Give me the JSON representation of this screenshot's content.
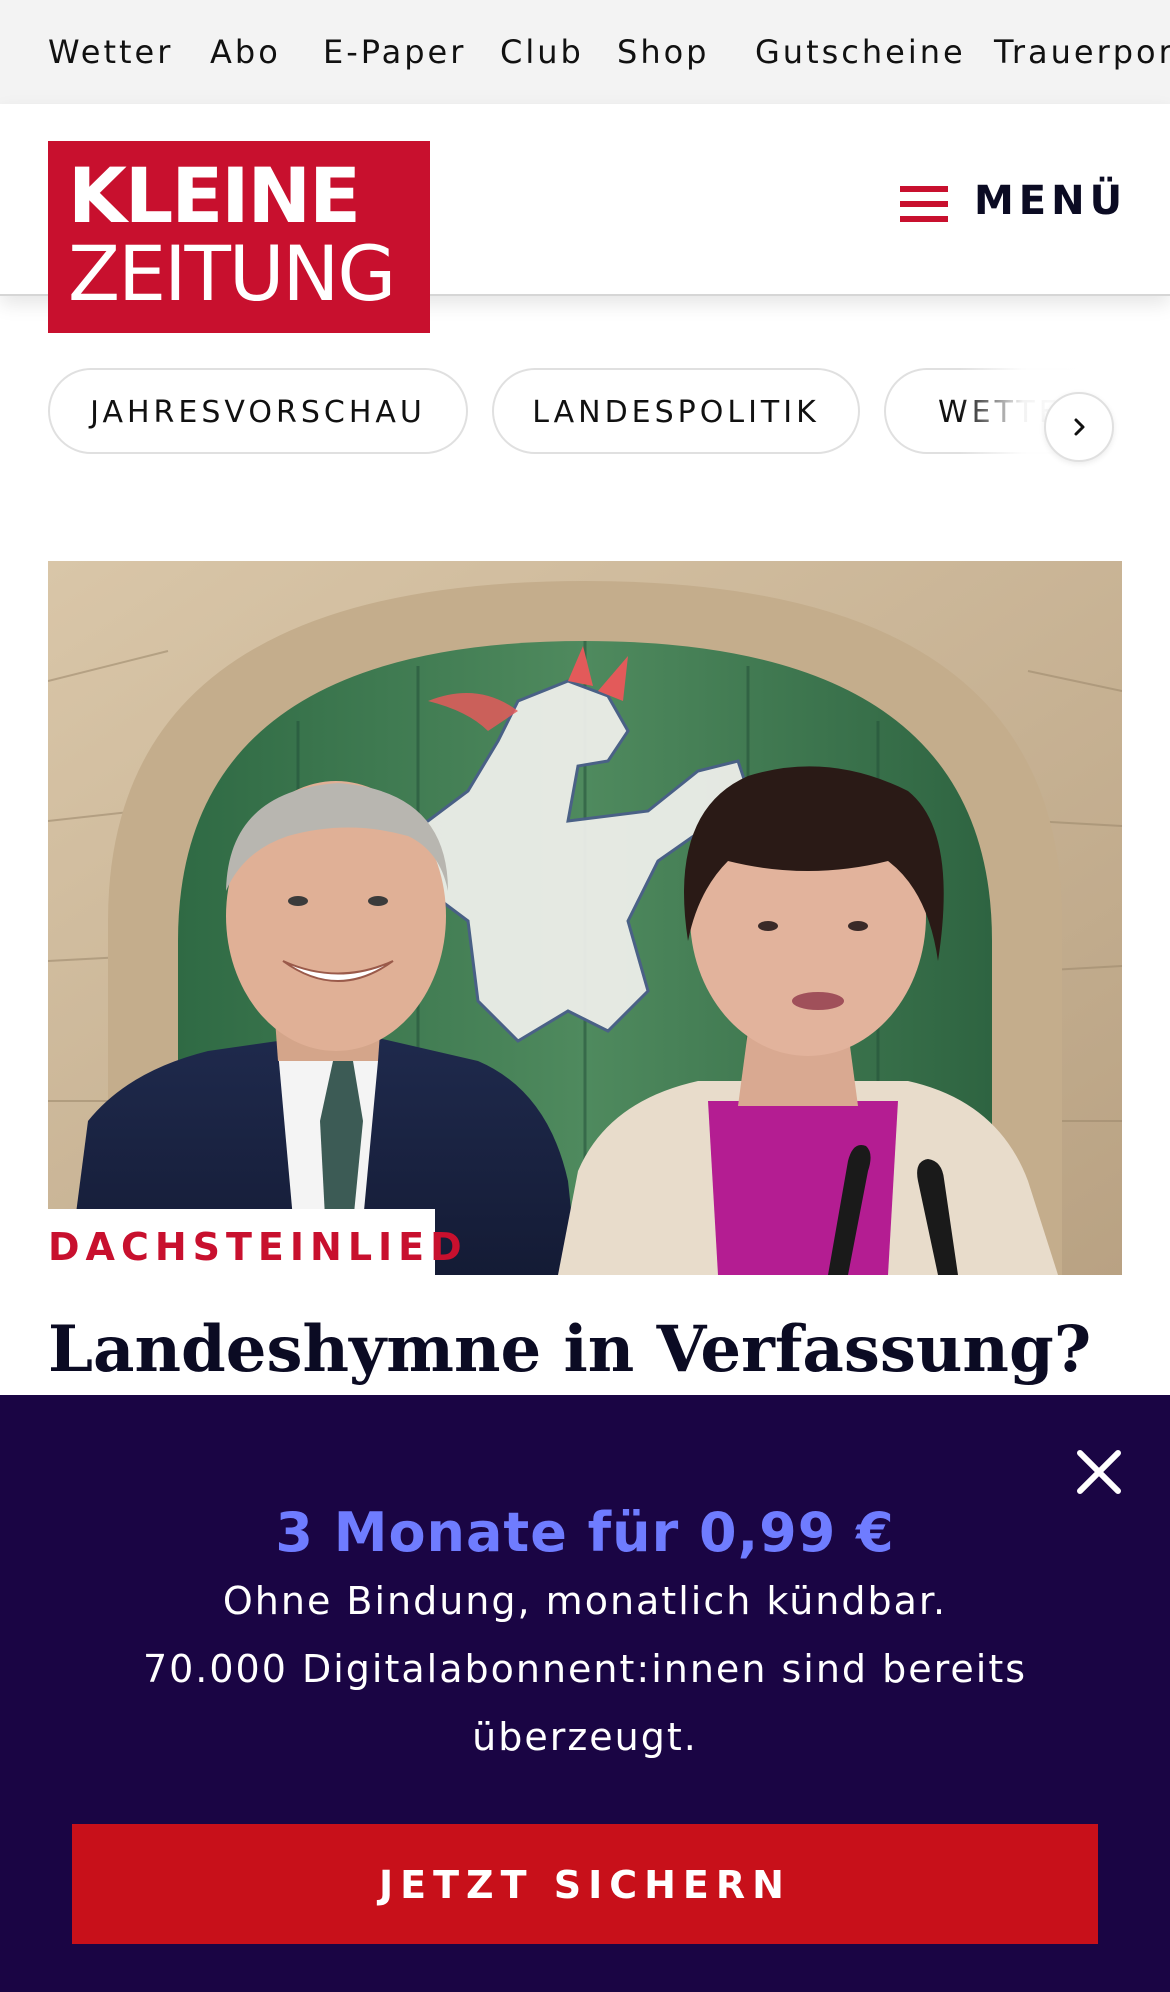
{
  "topnav": {
    "items": [
      {
        "label": "Wetter"
      },
      {
        "label": "Abo"
      },
      {
        "label": "E-Paper"
      },
      {
        "label": "Club"
      },
      {
        "label": "Shop"
      },
      {
        "label": "Gutscheine"
      },
      {
        "label": "Trauerportal"
      }
    ]
  },
  "header": {
    "logo_line1": "KLEINE",
    "logo_line2": "ZEITUNG",
    "menu_label": "MENÜ"
  },
  "topics": [
    {
      "label": "JAHRESVORSCHAU"
    },
    {
      "label": "LANDESPOLITIK"
    },
    {
      "label": "WETTER"
    }
  ],
  "article": {
    "kicker": "DACHSTEINLIED",
    "headline": "Landeshymne in Verfassung?"
  },
  "overlay": {
    "title": "3 Monate für 0,99 €",
    "line1": "Ohne Bindung, monatlich kündbar.",
    "line2": "70.000 Digitalabonnent:innen sind bereits",
    "line3": "überzeugt.",
    "cta_label": "JETZT SICHERN"
  },
  "colors": {
    "brand_red": "#c8102e",
    "overlay_bg": "#1a0544",
    "promo_accent": "#6f7cff",
    "cta_red": "#c8101a"
  }
}
